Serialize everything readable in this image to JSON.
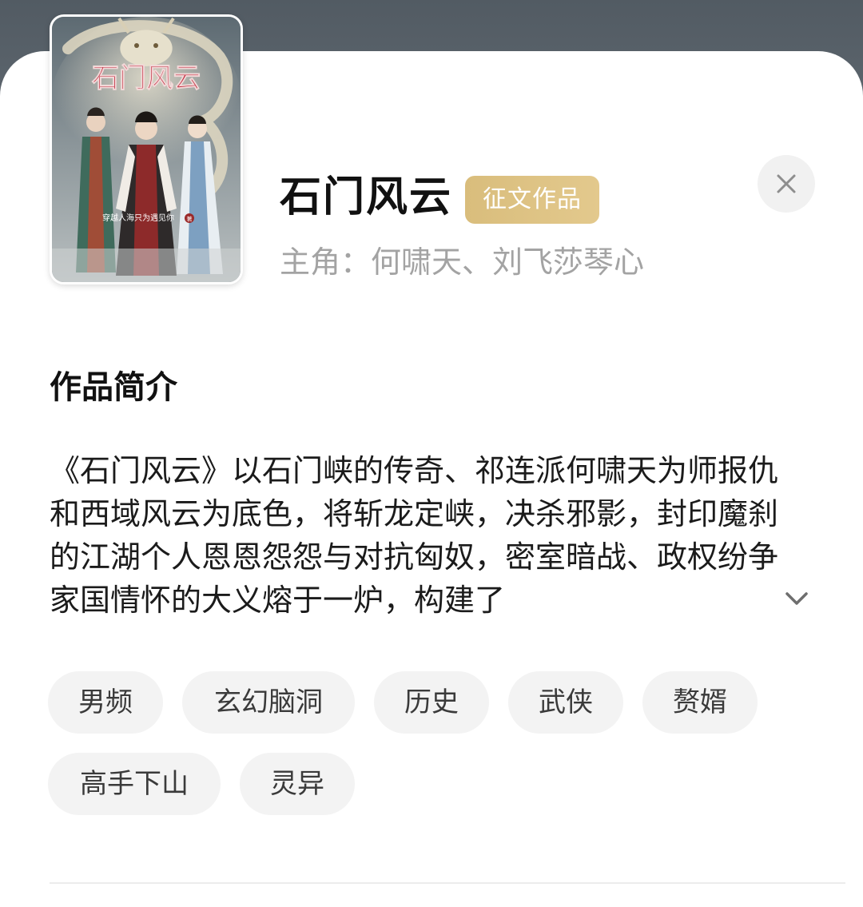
{
  "book": {
    "title": "石门风云",
    "badge": "征文作品",
    "protagonists": "主角：何啸天、刘飞莎琴心",
    "cover": {
      "title_text": "石门风云",
      "author_text": "穿越人海只为遇见你",
      "author_mark": "著"
    }
  },
  "synopsis": {
    "heading": "作品简介",
    "text": "《石门风云》以石门峡的传奇、祁连派何啸天为师报仇和西域风云为底色，将斩龙定峡，决杀邪影，封印魔刹的江湖个人恩恩怨怨与对抗匈奴，密室暗战、政权纷争家国情怀的大义熔于一炉，构建了",
    "expand_icon": "chevron-down-icon"
  },
  "tags": [
    "男频",
    "玄幻脑洞",
    "历史",
    "武侠",
    "赘婿",
    "高手下山",
    "灵异"
  ],
  "icons": {
    "close": "close-icon",
    "expand": "chevron-down-icon"
  },
  "colors": {
    "badge_gold": "#d9bd7c",
    "muted_text": "#a3a3a3",
    "tag_bg": "#f3f3f3"
  }
}
